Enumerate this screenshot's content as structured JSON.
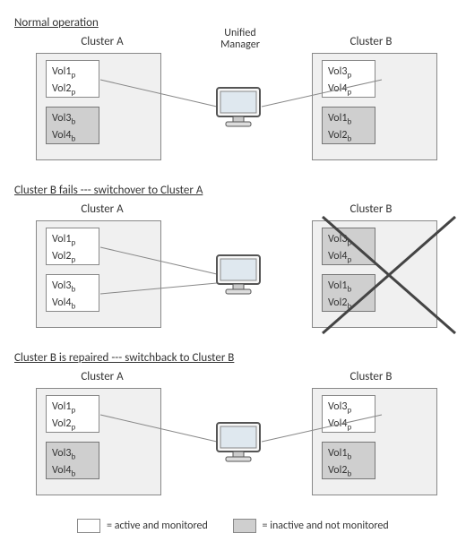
{
  "um_label": "Unified Manager",
  "legend": {
    "active": "= active and monitored",
    "inactive": "= inactive and not monitored"
  },
  "sections": [
    {
      "title": "Normal operation",
      "show_um_label": true,
      "clusterA": {
        "label": "Cluster A",
        "top": {
          "vols": [
            "Vol1ₚ",
            "Vol2ₚ"
          ],
          "active": true
        },
        "bottom": {
          "vols": [
            "Vol3_b",
            "Vol4_b"
          ],
          "active": false
        },
        "failed": false
      },
      "clusterB": {
        "label": "Cluster B",
        "top": {
          "vols": [
            "Vol3ₚ",
            "Vol4ₚ"
          ],
          "active": true
        },
        "bottom": {
          "vols": [
            "Vol1_b",
            "Vol2_b"
          ],
          "active": false
        },
        "failed": false
      },
      "links": {
        "a_top": true,
        "a_bottom": false,
        "b_top": true,
        "b_bottom": false
      }
    },
    {
      "title": "Cluster B fails --- switchover to Cluster A",
      "show_um_label": false,
      "clusterA": {
        "label": "Cluster A",
        "top": {
          "vols": [
            "Vol1ₚ",
            "Vol2ₚ"
          ],
          "active": true
        },
        "bottom": {
          "vols": [
            "Vol3_b",
            "Vol4_b"
          ],
          "active": true
        },
        "failed": false
      },
      "clusterB": {
        "label": "Cluster B",
        "top": {
          "vols": [
            "Vol3ₚ",
            "Vol4ₚ"
          ],
          "active": false
        },
        "bottom": {
          "vols": [
            "Vol1_b",
            "Vol2_b"
          ],
          "active": false
        },
        "failed": true
      },
      "links": {
        "a_top": true,
        "a_bottom": true,
        "b_top": false,
        "b_bottom": false
      }
    },
    {
      "title": "Cluster B is repaired --- switchback to Cluster B",
      "show_um_label": false,
      "clusterA": {
        "label": "Cluster A",
        "top": {
          "vols": [
            "Vol1ₚ",
            "Vol2ₚ"
          ],
          "active": true
        },
        "bottom": {
          "vols": [
            "Vol3_b",
            "Vol4_b"
          ],
          "active": false
        },
        "failed": false
      },
      "clusterB": {
        "label": "Cluster B",
        "top": {
          "vols": [
            "Vol3ₚ",
            "Vol4ₚ"
          ],
          "active": true
        },
        "bottom": {
          "vols": [
            "Vol1_b",
            "Vol2_b"
          ],
          "active": false
        },
        "failed": false
      },
      "links": {
        "a_top": true,
        "a_bottom": false,
        "b_top": true,
        "b_bottom": false
      }
    }
  ]
}
